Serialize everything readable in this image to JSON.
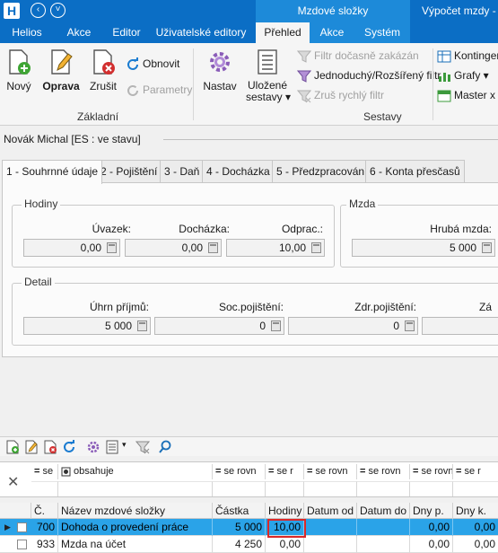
{
  "titlebar": {
    "logo": "H",
    "context_group": "Mzdové složky",
    "window_title": "Výpočet mzdy - b"
  },
  "ribbon_tabs": [
    {
      "label": "Helios"
    },
    {
      "label": "Akce"
    },
    {
      "label": "Editor"
    },
    {
      "label": "Uživatelské editory"
    },
    {
      "label": "Přehled"
    },
    {
      "label": "Akce"
    },
    {
      "label": "Systém"
    }
  ],
  "ribbon": {
    "zakladni": {
      "group_label": "Základní",
      "novy": "Nový",
      "oprava": "Oprava",
      "zrusit": "Zrušit",
      "obnovit": "Obnovit",
      "parametry": "Parametry"
    },
    "sestavy": {
      "group_label": "Sestavy",
      "nastav": "Nastav",
      "ulozene_line1": "Uložené",
      "ulozene_line2": "sestavy",
      "filtr_zakazan": "Filtr dočasně zakázán",
      "jednoduchy_filtr": "Jednoduchý/Rozšířený filtr",
      "zrus_filtr": "Zruš rychlý filtr"
    },
    "right": {
      "kontingen": "Kontingen",
      "grafy": "Grafy",
      "master": "Master x D"
    }
  },
  "employee": {
    "name": "Novák Michal",
    "status": "[ES : ve stavu]"
  },
  "section_tabs": [
    {
      "label": "1 - Souhrnné údaje"
    },
    {
      "label": "2 - Pojištění"
    },
    {
      "label": "3 - Daň"
    },
    {
      "label": "4 - Docházka"
    },
    {
      "label": "5 - Předzpracování"
    },
    {
      "label": "6 - Konta přesčasů"
    }
  ],
  "hodiny": {
    "legend": "Hodiny",
    "uvazek_label": "Úvazek:",
    "uvazek_value": "0,00",
    "dochazka_label": "Docházka:",
    "dochazka_value": "0,00",
    "odprac_label": "Odprac.:",
    "odprac_value": "10,00"
  },
  "mzda": {
    "legend": "Mzda",
    "hruba_label": "Hrubá mzda:",
    "hruba_value": "5 000"
  },
  "detail": {
    "legend": "Detail",
    "uhrn_label": "Úhrn příjmů:",
    "uhrn_value": "5 000",
    "soc_label": "Soc.pojištění:",
    "soc_value": "0",
    "zdr_label": "Zdr.pojištění:",
    "zdr_value": "0",
    "extra_label": "Zá"
  },
  "grid": {
    "filter_row": [
      {
        "op": "=",
        "text": "se"
      },
      {
        "op": "",
        "text": "obsahuje"
      },
      {
        "op": "=",
        "text": "se rovn"
      },
      {
        "op": "=",
        "text": "se r"
      },
      {
        "op": "=",
        "text": "se rovn"
      },
      {
        "op": "=",
        "text": "se rovn"
      },
      {
        "op": "=",
        "text": "se rovn"
      },
      {
        "op": "=",
        "text": "se r"
      }
    ],
    "columns": [
      "Č.",
      "Název mzdové složky",
      "Částka",
      "Hodiny",
      "Datum od",
      "Datum do",
      "Dny p.",
      "Dny k."
    ],
    "rows": [
      {
        "cislo": "700",
        "nazev": "Dohoda o provedení práce",
        "castka": "5 000",
        "hodiny": "10,00",
        "datum_od": "",
        "datum_do": "",
        "dny_p": "0,00",
        "dny_k": "0,00"
      },
      {
        "cislo": "933",
        "nazev": "Mzda na účet",
        "castka": "4 250",
        "hodiny": "0,00",
        "datum_od": "",
        "datum_do": "",
        "dny_p": "0,00",
        "dny_k": "0,00"
      }
    ]
  },
  "colors": {
    "title_blue": "#0b6ec5",
    "context_blue": "#1d8ad9",
    "selected_row": "#2aa3e8",
    "highlight_red": "#d92929"
  }
}
